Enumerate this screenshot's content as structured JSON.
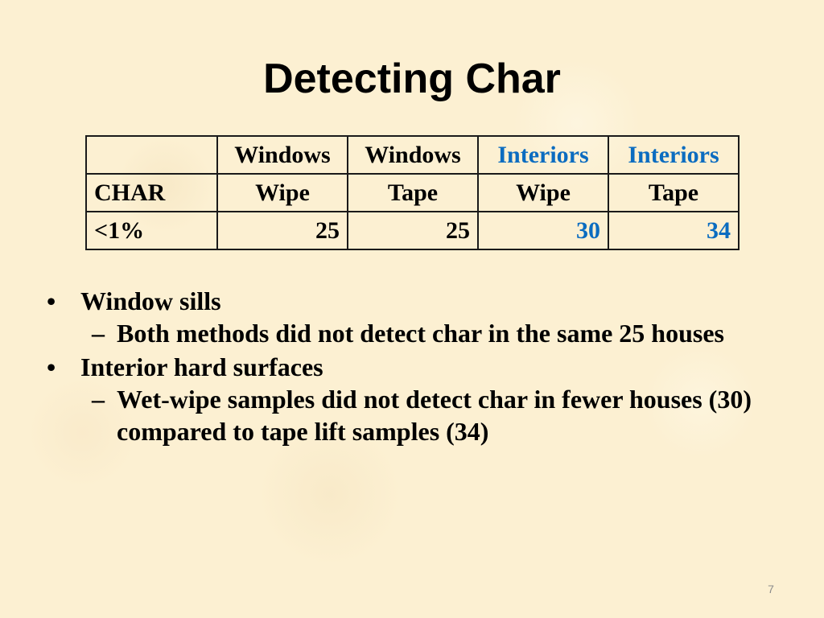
{
  "slide": {
    "title": "Detecting Char",
    "page_number": "7"
  },
  "colors": {
    "accent_blue": "#0b6cc0",
    "background": "#fcf0d2",
    "text": "#000000"
  },
  "table": {
    "header_row1": [
      "",
      "Windows",
      "Windows",
      "Interiors",
      "Interiors"
    ],
    "header_row2": [
      "CHAR",
      "Wipe",
      "Tape",
      "Wipe",
      "Tape"
    ],
    "data_row": [
      "<1%",
      "25",
      "25",
      "30",
      "34"
    ]
  },
  "bullets": [
    {
      "marker": "•",
      "text": "Window sills",
      "sub": [
        {
          "marker": "–",
          "text": "Both methods did not detect char in the same 25 houses"
        }
      ]
    },
    {
      "marker": "•",
      "text": "Interior hard surfaces",
      "sub": [
        {
          "marker": "–",
          "text": "Wet-wipe samples did not detect char in fewer houses (30) compared to tape lift samples (34)"
        }
      ]
    }
  ]
}
